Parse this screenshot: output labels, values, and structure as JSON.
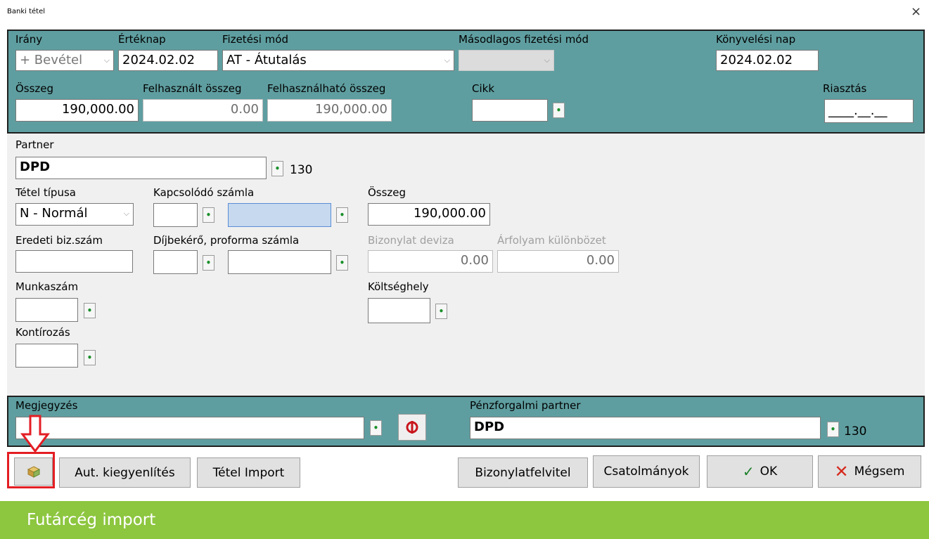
{
  "window": {
    "title": "Banki tétel",
    "close_glyph": "×"
  },
  "top": {
    "irany_label": "Irány",
    "irany_value": "+ Bevétel",
    "erteknap_label": "Értéknap",
    "erteknap_value": "2024.02.02",
    "fizetesi_mod_label": "Fizetési mód",
    "fizetesi_mod_value": "AT - Átutalás",
    "masodlagos_label": "Másodlagos fizetési mód",
    "masodlagos_value": "",
    "konyvelesi_nap_label": "Könyvelési nap",
    "konyvelesi_nap_value": "2024.02.02",
    "osszeg_label": "Összeg",
    "osszeg_value": "190,000.00",
    "felhasznalt_label": "Felhasznált összeg",
    "felhasznalt_value": "0.00",
    "felhasznalhato_label": "Felhasználható összeg",
    "felhasznalhato_value": "190,000.00",
    "cikk_label": "Cikk",
    "cikk_value": "",
    "riasztas_label": "Riasztás",
    "riasztas_value": "____.__.__"
  },
  "middle": {
    "partner_label": "Partner",
    "partner_value": "DPD",
    "partner_number": "130",
    "tetel_tipusa_label": "Tétel típusa",
    "tetel_tipusa_value": "N - Normál",
    "kapcsolodo_szamla_label": "Kapcsolódó számla",
    "osszeg_label": "Összeg",
    "osszeg_value": "190,000.00",
    "eredeti_label": "Eredeti biz.szám",
    "dijbekero_label": "Díjbekérő, proforma számla",
    "bizonylat_deviza_label": "Bizonylat deviza",
    "bizonylat_deviza_value": "0.00",
    "arfolyam_label": "Árfolyam különbözet",
    "arfolyam_value": "0.00",
    "munkaszam_label": "Munkaszám",
    "koltseghely_label": "Költséghely",
    "kontirozas_label": "Kontírozás"
  },
  "bottom": {
    "megjegyzes_label": "Megjegyzés",
    "megjegyzes_value": "",
    "penzforgalmi_label": "Pénzforgalmi partner",
    "penzforgalmi_value": "DPD",
    "penzforgalmi_number": "130"
  },
  "buttons": {
    "aut_kiegyenlites": "Aut. kiegyenlítés",
    "tetel_import": "Tétel Import",
    "bizonylatfelvitel": "Bizonylatfelvitel",
    "csatolmanyok": "Csatolmányok",
    "ok": "OK",
    "ok_glyph": "✓",
    "megsem": "Mégsem",
    "megsem_glyph": "✕"
  },
  "picker_glyph": "•",
  "dropdown_glyph": "⌵",
  "footer": {
    "caption": "Futárcég import"
  },
  "colors": {
    "panel": "#5f9ea0",
    "highlight": "#e31e24",
    "footer": "#8dc63f"
  }
}
